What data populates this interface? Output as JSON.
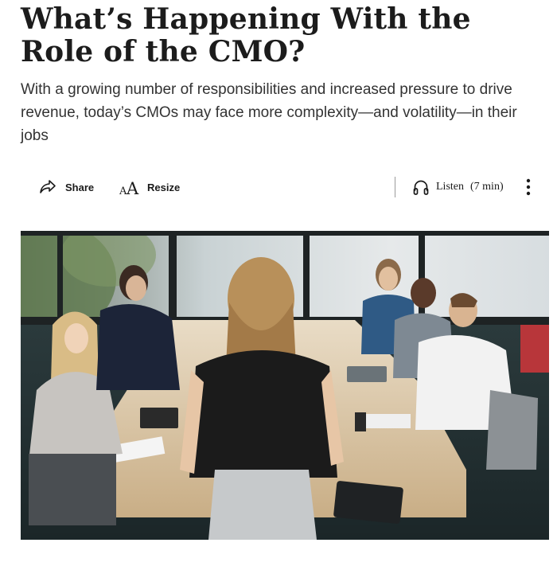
{
  "article": {
    "headline": "What’s Happening With the Role of the CMO?",
    "dek": "With a growing number of responsibilities and increased pressure to drive revenue, today’s CMOs may face more complexity—and volatility—in their jobs"
  },
  "toolbar": {
    "share_label": "Share",
    "resize_label": "Resize",
    "listen_label": "Listen",
    "listen_duration": "(7 min)",
    "icons": [
      "share-icon",
      "resize-icon",
      "headphones-icon",
      "more-vertical-icon"
    ]
  },
  "hero_image": {
    "alt": "A woman stands at the head of a conference table addressing seated colleagues in a bright office"
  },
  "colors": {
    "text": "#1c1c1c",
    "dek_text": "#333333",
    "divider": "#9a9a9a"
  }
}
